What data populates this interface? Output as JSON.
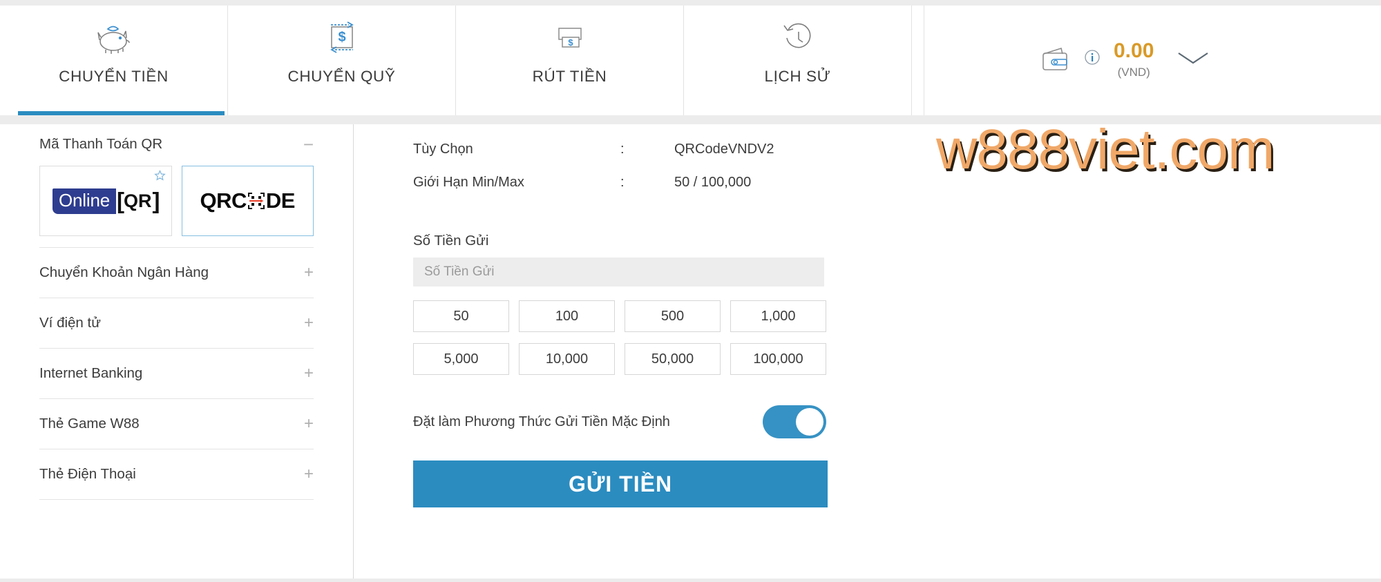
{
  "tabs": [
    {
      "label": "CHUYỂN TIỀN",
      "icon": "piggy-bank-icon",
      "active": true
    },
    {
      "label": "CHUYỂN QUỸ",
      "icon": "transfer-funds-icon",
      "active": false
    },
    {
      "label": "RÚT TIỀN",
      "icon": "withdraw-cash-icon",
      "active": false
    },
    {
      "label": "LỊCH SỬ",
      "icon": "history-clock-icon",
      "active": false
    }
  ],
  "wallet": {
    "icon": "wallet-icon",
    "info_icon": "info-circle-icon",
    "balance": "0.00",
    "currency": "(VND)",
    "chevron_icon": "chevron-down-icon",
    "accent_color": "#d99a28"
  },
  "sidebar": {
    "sections": [
      {
        "title": "Mã Thanh Toán QR",
        "sign": "−",
        "expanded": true
      },
      {
        "title": "Chuyển Khoản Ngân Hàng",
        "sign": "+",
        "expanded": false
      },
      {
        "title": "Ví điện tử",
        "sign": "+",
        "expanded": false
      },
      {
        "title": "Internet Banking",
        "sign": "+",
        "expanded": false
      },
      {
        "title": "Thẻ Game W88",
        "sign": "+",
        "expanded": false
      },
      {
        "title": "Thẻ Điện Thoại",
        "sign": "+",
        "expanded": false
      }
    ],
    "tiles": [
      {
        "name": "OnlineQR",
        "part1": "Online",
        "part2": "QR",
        "favorite_icon": "star-icon",
        "selected": false
      },
      {
        "name": "QRCODE",
        "part1": "QRC",
        "part2": "DE",
        "middle_icon": "qr-scan-icon",
        "selected": true
      }
    ]
  },
  "form": {
    "info": [
      {
        "label": "Tùy Chọn",
        "separator": ":",
        "value": "QRCodeVNDV2"
      },
      {
        "label": "Giới Hạn Min/Max",
        "separator": ":",
        "value": "50 / 100,000"
      }
    ],
    "amount_label": "Số Tiền Gửi",
    "amount_placeholder": "Số Tiền Gửi",
    "amount_value": "",
    "quick_amounts": [
      "50",
      "100",
      "500",
      "1,000",
      "5,000",
      "10,000",
      "50,000",
      "100,000"
    ],
    "default_method_label": "Đặt làm Phương Thức Gửi Tiền Mặc Định",
    "default_method_on": true,
    "submit_label": "GỬI TIỀN",
    "accent_color": "#2b8cc0"
  },
  "watermark": {
    "text": "w888viet.com",
    "color": "#f0a868"
  }
}
